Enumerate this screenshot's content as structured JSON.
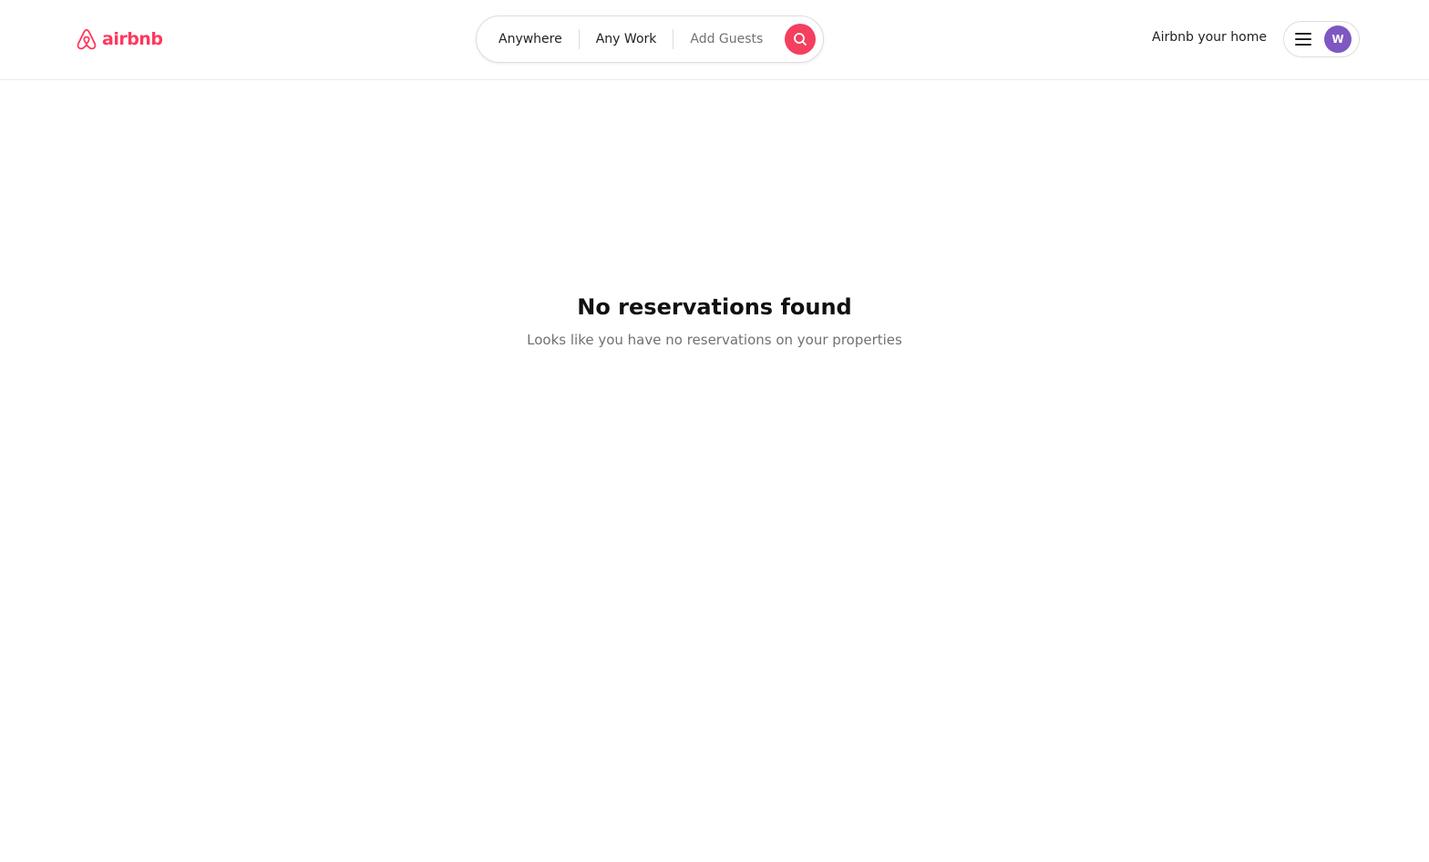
{
  "brand": {
    "name": "airbnb",
    "logo_icon": "airbnb-belo-icon",
    "color": "#FF385C"
  },
  "search": {
    "location_label": "Anywhere",
    "work_label": "Any Work",
    "guests_label": "Add Guests",
    "search_icon": "search-icon",
    "button_color": "#F43F5E"
  },
  "header": {
    "host_link": "Airbnb your home",
    "menu_icon": "hamburger-menu-icon",
    "avatar_initial": "W",
    "avatar_color": "#7E57C2"
  },
  "empty_state": {
    "title": "No reservations found",
    "subtitle": "Looks like you have no reservations on your properties"
  }
}
